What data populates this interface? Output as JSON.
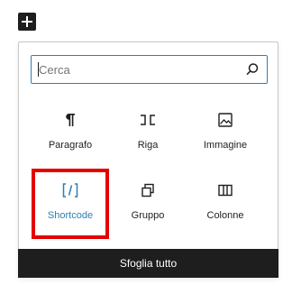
{
  "toggle": {
    "icon": "plus-icon"
  },
  "search": {
    "placeholder": "Cerca",
    "value": "",
    "icon": "search-icon"
  },
  "blocks": [
    {
      "label": "Paragrafo",
      "icon": "paragraph-icon"
    },
    {
      "label": "Riga",
      "icon": "row-icon"
    },
    {
      "label": "Immagine",
      "icon": "image-icon"
    },
    {
      "label": "Shortcode",
      "icon": "shortcode-icon",
      "highlighted": true
    },
    {
      "label": "Gruppo",
      "icon": "group-icon"
    },
    {
      "label": "Colonne",
      "icon": "columns-icon"
    }
  ],
  "browse_all": {
    "label": "Sfoglia tutto"
  },
  "colors": {
    "accent": "#2f7fb6",
    "highlight": "#e50000",
    "dark": "#1e1e1e"
  }
}
